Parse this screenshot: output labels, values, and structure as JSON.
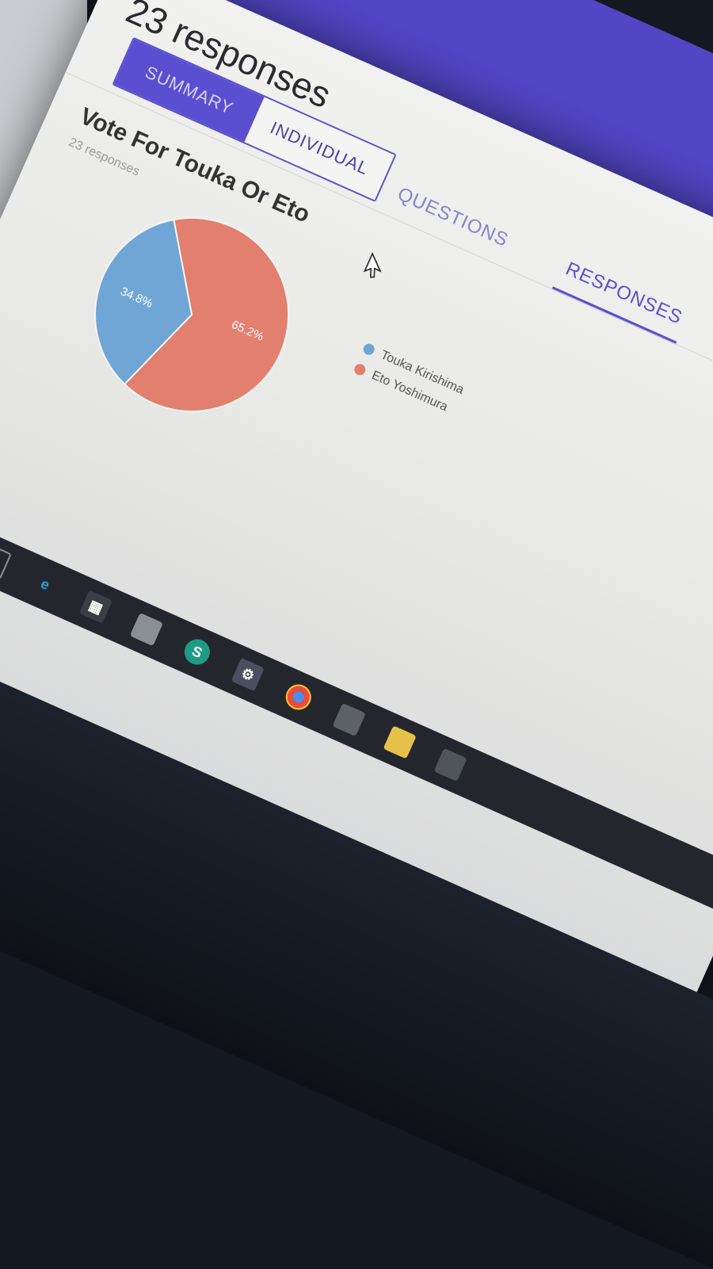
{
  "header": {
    "title": "23 responses",
    "tabs": [
      {
        "label": "QUESTIONS",
        "active": false
      },
      {
        "label": "RESPONSES",
        "active": true
      }
    ]
  },
  "view_toggle": {
    "summary_label": "SUMMARY",
    "individual_label": "INDIVIDUAL",
    "selected": "SUMMARY"
  },
  "question": {
    "title": "Vote For Touka Or Eto",
    "response_count": "23 responses"
  },
  "chart_data": {
    "type": "pie",
    "slices": [
      {
        "label": "Touka Kirishima",
        "percent": 34.8,
        "display": "34.8%",
        "color": "#6fa6d6"
      },
      {
        "label": "Eto Yoshimura",
        "percent": 65.2,
        "display": "65.2%",
        "color": "#e27f6f"
      }
    ],
    "legend_position": "right"
  },
  "colors": {
    "accent": "#5a4fd1"
  },
  "taskbar": {
    "icons": [
      "window-icon",
      "edge-icon",
      "store-icon",
      "file-explorer-icon",
      "app-green-icon",
      "settings-icon",
      "chrome-icon",
      "window-icon",
      "folder-icon",
      "window-icon"
    ]
  }
}
